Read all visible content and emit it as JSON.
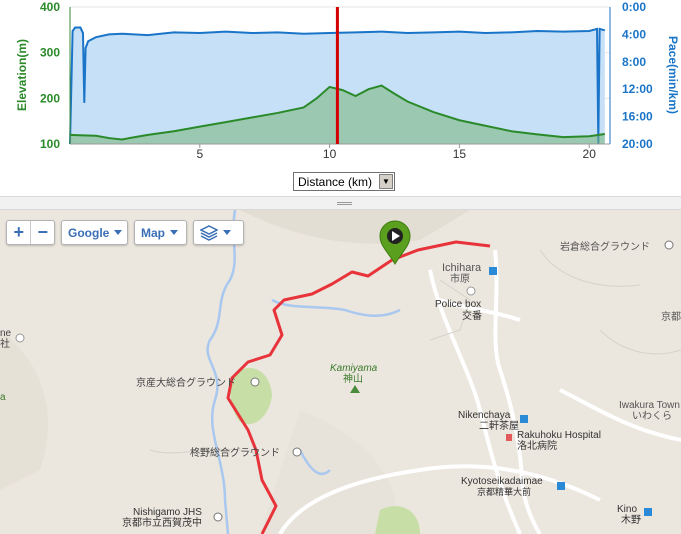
{
  "chart": {
    "left_axis_label": "Elevation(m)",
    "right_axis_label": "Pace(min/km)",
    "left_ticks": [
      "400",
      "300",
      "200",
      "100"
    ],
    "right_ticks": [
      "0:00",
      "4:00",
      "8:00",
      "12:00",
      "16:00",
      "20:00"
    ],
    "x_ticks": [
      "5",
      "10",
      "15",
      "20"
    ],
    "axis_select_value": "Distance (km)",
    "colors": {
      "elevation": "#2a8a2a",
      "pace": "#1a74c8",
      "cursor": "#d40000"
    }
  },
  "chart_data": {
    "type": "area",
    "xlabel": "",
    "ylabel": "Elevation(m)",
    "y2label": "Pace(min/km)",
    "xlim": [
      0,
      20.8
    ],
    "ylim": [
      100,
      400
    ],
    "y2lim_minutes": [
      0,
      20
    ],
    "cursor_x": 10.3,
    "series": [
      {
        "name": "Elevation(m)",
        "x": [
          0,
          0.5,
          1,
          1.5,
          2,
          2.5,
          3,
          4,
          5,
          6,
          7,
          8,
          9,
          9.5,
          10,
          10.5,
          11,
          11.5,
          12,
          12.5,
          13,
          14,
          15,
          16,
          17,
          18,
          19,
          20,
          20.6
        ],
        "y": [
          120,
          119,
          118,
          113,
          110,
          115,
          120,
          128,
          138,
          148,
          158,
          168,
          180,
          200,
          225,
          218,
          205,
          220,
          228,
          210,
          193,
          170,
          152,
          140,
          128,
          121,
          115,
          117,
          122
        ]
      },
      {
        "name": "Pace(min/km)",
        "x": [
          0,
          0.1,
          0.2,
          0.4,
          0.5,
          0.55,
          0.6,
          0.7,
          1,
          1.5,
          2,
          3,
          4,
          5,
          6,
          7,
          8,
          9,
          10,
          11,
          12,
          13,
          14,
          15,
          16,
          17,
          18,
          19,
          20,
          20.3,
          20.35,
          20.4,
          20.6
        ],
        "y": [
          20,
          3.5,
          3.0,
          3.0,
          3.8,
          14.0,
          6.0,
          5.0,
          4.4,
          4.0,
          3.9,
          4.1,
          3.7,
          3.8,
          3.6,
          3.8,
          3.7,
          3.9,
          3.8,
          3.7,
          3.6,
          3.8,
          3.7,
          3.6,
          3.8,
          3.7,
          3.5,
          3.6,
          3.5,
          3.2,
          20,
          3.2,
          3.4
        ]
      }
    ]
  },
  "map": {
    "zoom_in": "+",
    "zoom_out": "−",
    "provider_label": "Google",
    "type_label": "Map",
    "labels": {
      "ichihara": "Ichihara",
      "ichihara_jp": "市原",
      "iwakura_ground": "岩倉総合グラウンド",
      "police": "Police box",
      "police_jp": "交番",
      "kyoto_edge": "京都",
      "kamiyama": "Kamiyama",
      "kamiyama_jp": "神山",
      "kyosan": "京産大総合グラウンド",
      "hiirag": "柊野総合グラウンド",
      "nikenchaya": "Nikenchaya",
      "nikenchaya_jp": "二軒茶屋",
      "rakuhoku": "Rakuhoku Hospital",
      "rakuhoku_jp": "洛北病院",
      "iwakura": "Iwakura Town",
      "iwakura_jp": "いわくら",
      "kyotoseika": "Kyotoseikadaimae",
      "kyotoseika_jp": "京都精華大前",
      "nishigamo": "Nishigamo JHS",
      "nishigamo_jp": "京都市立西賀茂中",
      "kino": "Kino",
      "kino_jp": "木野",
      "left_ne": "ne",
      "left_sha": "社",
      "left_a": "a"
    },
    "colors": {
      "route": "#e8333a",
      "marker": "#5aa01e",
      "park": "#c7dfa7",
      "water": "#a9c8ef"
    }
  }
}
